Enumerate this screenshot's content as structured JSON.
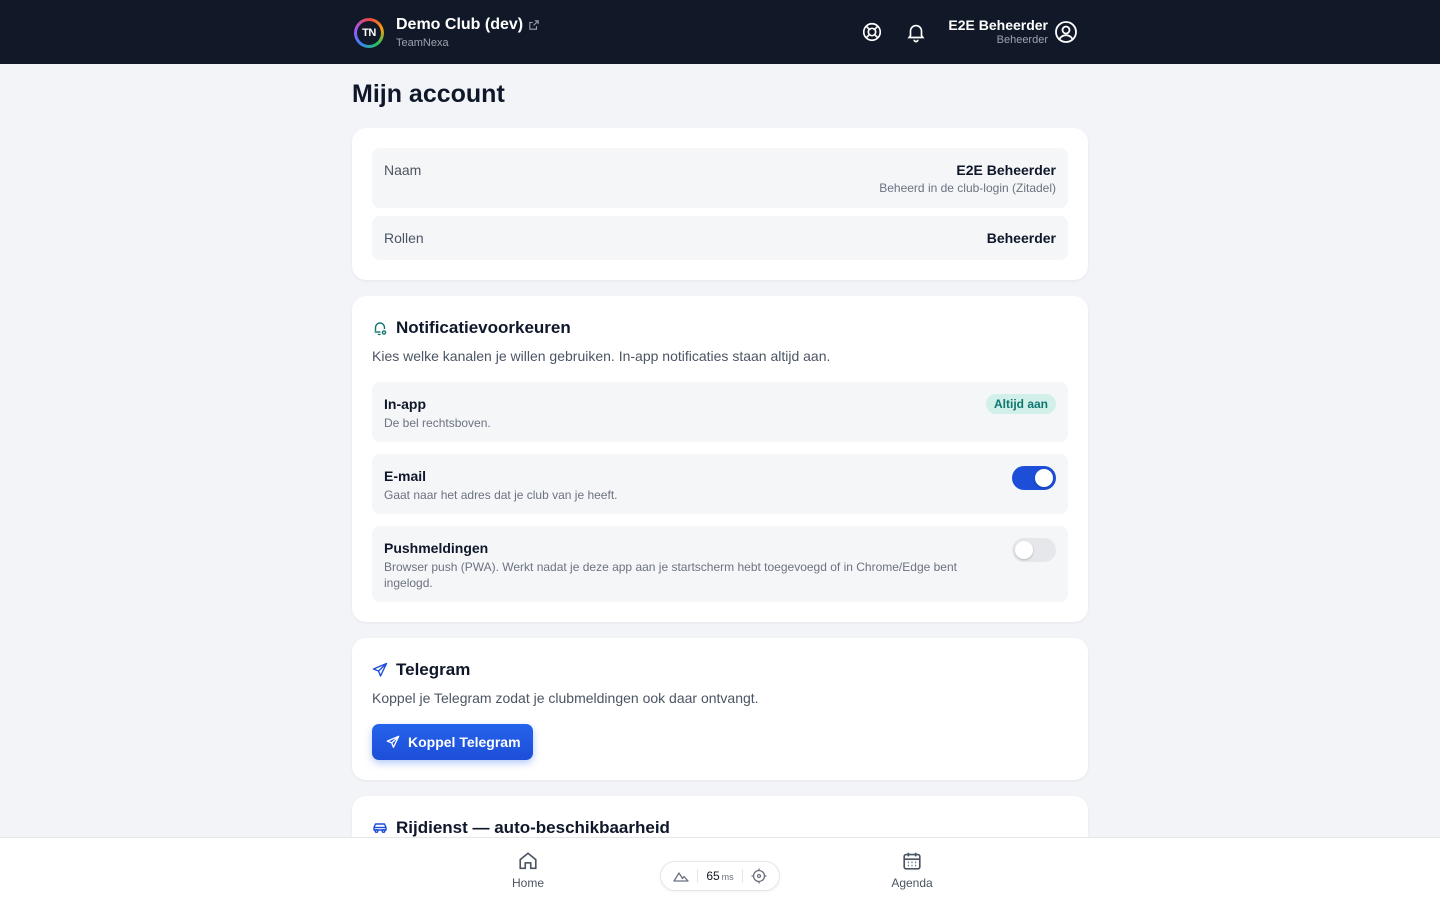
{
  "header": {
    "club_name": "Demo Club (dev)",
    "org_name": "TeamNexa",
    "logo_text": "TN",
    "user_name": "E2E Beheerder",
    "user_role": "Beheerder"
  },
  "page": {
    "title": "Mijn account"
  },
  "account": {
    "name_label": "Naam",
    "name_value": "E2E Beheerder",
    "name_hint": "Beheerd in de club-login (Zitadel)",
    "roles_label": "Rollen",
    "roles_value": "Beheerder"
  },
  "notifications": {
    "title": "Notificatievoorkeuren",
    "description": "Kies welke kanalen je willen gebruiken. In-app notificaties staan altijd aan.",
    "channels": [
      {
        "title": "In-app",
        "description": "De bel rechtsboven.",
        "badge": "Altijd aan"
      },
      {
        "title": "E-mail",
        "description": "Gaat naar het adres dat je club van je heeft.",
        "enabled": true
      },
      {
        "title": "Pushmeldingen",
        "description": "Browser push (PWA). Werkt nadat je deze app aan je startscherm hebt toegevoegd of in Chrome/Edge bent ingelogd.",
        "enabled": false
      }
    ]
  },
  "telegram": {
    "title": "Telegram",
    "description": "Koppel je Telegram zodat je clubmeldingen ook daar ontvangt.",
    "button_label": "Koppel Telegram"
  },
  "ride": {
    "title": "Rijdienst — auto-beschikbaarheid"
  },
  "bottom_nav": {
    "home_label": "Home",
    "agenda_label": "Agenda",
    "latency_value": "65",
    "latency_unit": "ms"
  },
  "colors": {
    "header_bg": "#111827",
    "accent": "#1d4ed8",
    "badge_bg": "#d1f0ea",
    "badge_text": "#0f766e",
    "page_bg": "#f3f4f7"
  },
  "icons": [
    "external-link-icon",
    "lifebuoy-icon",
    "bell-icon",
    "user-circle-icon",
    "bell-settings-icon",
    "send-icon",
    "car-icon",
    "home-icon",
    "calendar-icon",
    "mountain-icon",
    "crosshair-icon"
  ]
}
